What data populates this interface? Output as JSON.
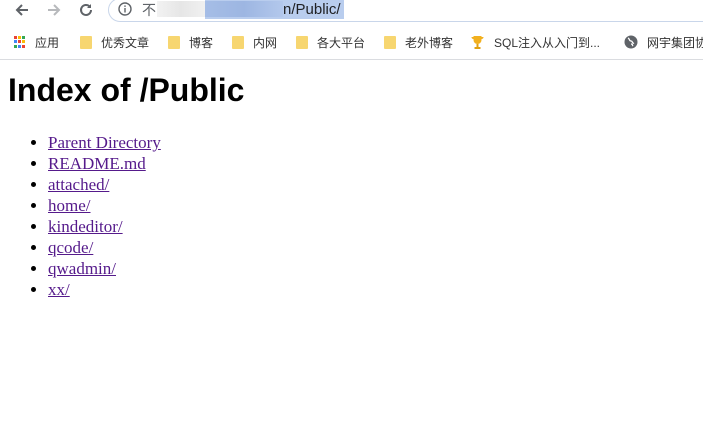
{
  "omnibox": {
    "security_prefix": "不",
    "url_visible_tail": "n/Public/"
  },
  "bookmarks": [
    {
      "label": "应用",
      "icon": "apps-grid-icon"
    },
    {
      "label": "优秀文章",
      "icon": "folder-icon"
    },
    {
      "label": "博客",
      "icon": "folder-icon"
    },
    {
      "label": "内网",
      "icon": "folder-icon"
    },
    {
      "label": "各大平台",
      "icon": "folder-icon"
    },
    {
      "label": "老外博客",
      "icon": "folder-icon"
    },
    {
      "label": "SQL注入从入门到...",
      "icon": "trophy-icon"
    },
    {
      "label": "网宇集团协",
      "icon": "globe-icon"
    }
  ],
  "page": {
    "title": "Index of /Public",
    "entries": [
      "Parent Directory",
      "README.md",
      "attached/",
      "home/",
      "kindeditor/",
      "qcode/",
      "qwadmin/",
      "xx/"
    ]
  },
  "colors": {
    "link_visited": "#551a8b",
    "url_selection": "#b9cdee",
    "folder": "#f7d670"
  }
}
